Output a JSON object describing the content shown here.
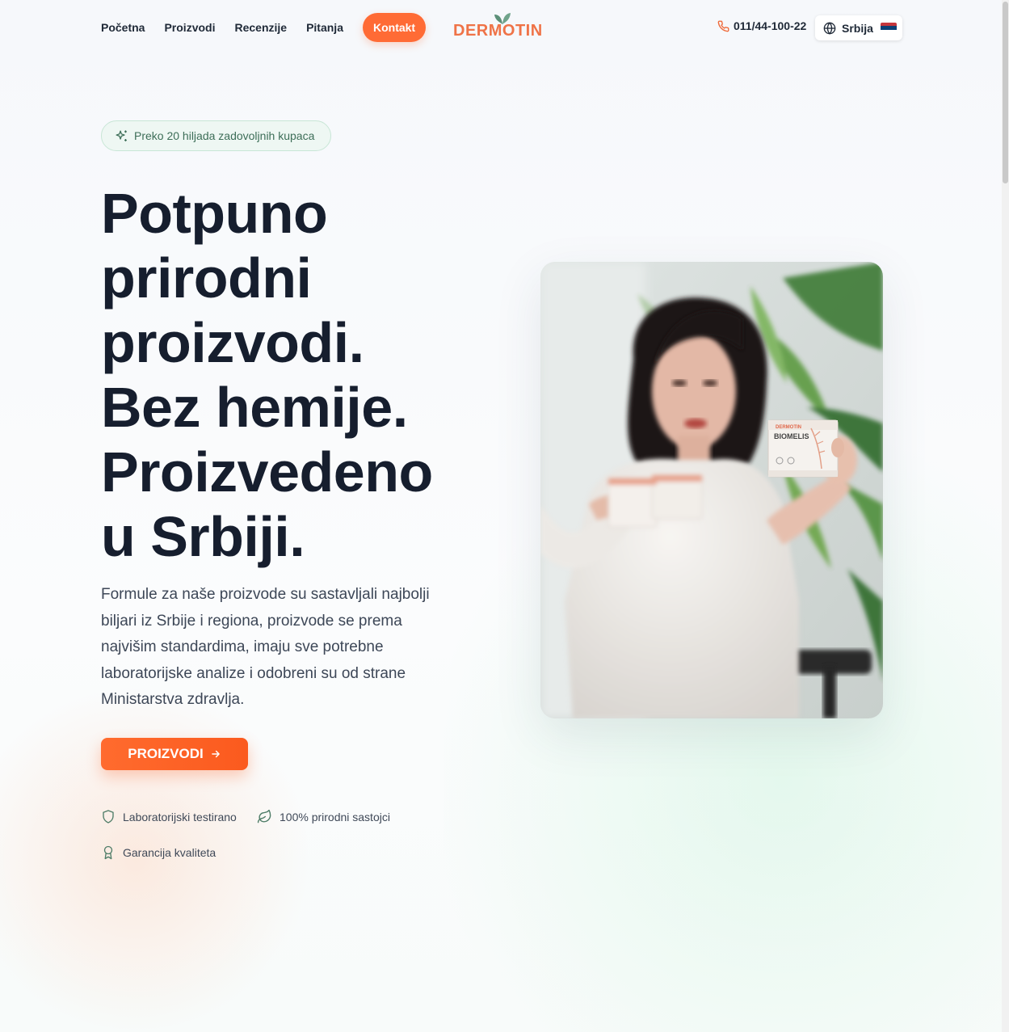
{
  "nav": {
    "items": [
      "Početna",
      "Proizvodi",
      "Recenzije",
      "Pitanja"
    ],
    "cta": "Kontakt"
  },
  "brand": {
    "name": "DERMOTIN"
  },
  "contact": {
    "phone": "011/44-100-22"
  },
  "language": {
    "label": "Srbija"
  },
  "hero": {
    "badge": "Preko 20 hiljada zadovoljnih kupaca",
    "headline": [
      "Potpuno",
      "prirodni",
      "proizvodi.",
      "Bez hemije.",
      "Proizvedeno",
      "u Srbiji."
    ],
    "description": "Formule za naše proizvode su sastavljali najbolji biljari iz Srbije i regiona, proizvode se prema najvišim standardima, imaju sve potrebne laboratorijske analize i odobreni su od strane Ministarstva zdravlja.",
    "cta": "PROIZVODI",
    "features": [
      "Laboratorijski testirano",
      "100% prirodni sastojci",
      "Garancija kvaliteta"
    ]
  },
  "photo": {
    "product_label": "BIOMELIS",
    "product_brand": "DERMOTIN"
  },
  "colors": {
    "accent": "#ff6b35",
    "brand": "#ef7347",
    "leaf": "#5b8f78",
    "text": "#161e2e"
  }
}
